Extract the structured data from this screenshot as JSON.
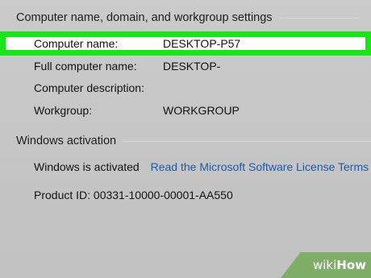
{
  "computer_section": {
    "title": "Computer name, domain, and workgroup settings",
    "rows": [
      {
        "label": "Computer name:",
        "value": "DESKTOP-P57"
      },
      {
        "label": "Full computer name:",
        "value": "DESKTOP-"
      },
      {
        "label": "Computer description:",
        "value": ""
      },
      {
        "label": "Workgroup:",
        "value": "WORKGROUP"
      }
    ]
  },
  "activation_section": {
    "title": "Windows activation",
    "status": "Windows is activated",
    "license_link": "Read the Microsoft Software License Terms",
    "product_id": "Product ID: 00331-10000-00001-AA550"
  },
  "watermark": {
    "wiki": "wiki",
    "how": "How"
  },
  "colors": {
    "highlight_border": "#19e619",
    "link": "#1f5aa6",
    "badge": "#7fae68"
  }
}
